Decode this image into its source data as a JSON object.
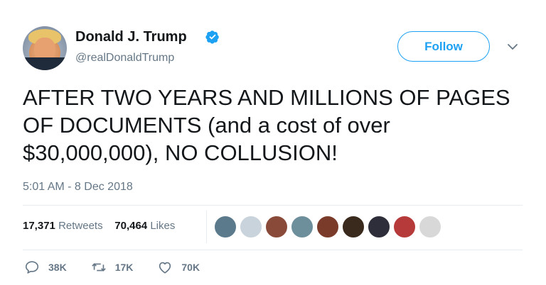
{
  "author": {
    "name": "Donald J. Trump",
    "handle": "@realDonaldTrump",
    "verified": true
  },
  "follow_label": "Follow",
  "tweet": {
    "text": "AFTER TWO YEARS AND MILLIONS OF PAGES OF DOCUMENTS (and a cost of over $30,000,000), NO COLLUSION!",
    "timestamp": "5:01 AM - 8 Dec 2018"
  },
  "stats": {
    "retweets_count": "17,371",
    "retweets_label": "Retweets",
    "likes_count": "70,464",
    "likes_label": "Likes"
  },
  "liker_avatars": [
    {
      "name": "liker-avatar-1",
      "color": "#5b7a8c"
    },
    {
      "name": "liker-avatar-2",
      "color": "#c9d3dc"
    },
    {
      "name": "liker-avatar-3",
      "color": "#8a4a3a"
    },
    {
      "name": "liker-avatar-4",
      "color": "#6d8f9c"
    },
    {
      "name": "liker-avatar-5",
      "color": "#7a3b2a"
    },
    {
      "name": "liker-avatar-6",
      "color": "#3a2a1e"
    },
    {
      "name": "liker-avatar-7",
      "color": "#2e2e3a"
    },
    {
      "name": "liker-avatar-8",
      "color": "#b63a3a"
    },
    {
      "name": "liker-avatar-9",
      "color": "#d8d8d8"
    }
  ],
  "actions": {
    "replies": "38K",
    "retweets": "17K",
    "likes": "70K"
  },
  "colors": {
    "accent": "#1da1f2",
    "muted": "#657786",
    "text": "#14171a"
  },
  "icons": [
    "verified-badge-icon",
    "chevron-down-icon",
    "reply-icon",
    "retweet-icon",
    "like-icon"
  ]
}
